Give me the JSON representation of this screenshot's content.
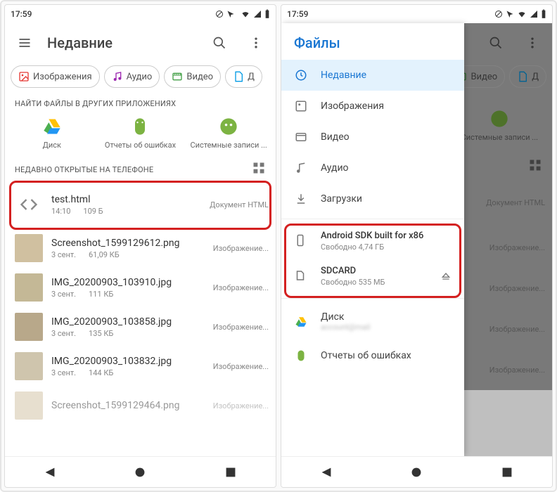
{
  "left": {
    "time": "17:59",
    "appbar_title": "Недавние",
    "chips": [
      {
        "icon": "image-icon",
        "label": "Изображения",
        "color": "#e53935"
      },
      {
        "icon": "music-icon",
        "label": "Аудио",
        "color": "#9c27b0"
      },
      {
        "icon": "video-icon",
        "label": "Видео",
        "color": "#43a047"
      },
      {
        "icon": "doc-icon",
        "label": "Д",
        "color": "#039be5"
      }
    ],
    "section_find": "НАЙТИ ФАЙЛЫ В ДРУГИХ ПРИЛОЖЕНИЯХ",
    "apps": [
      {
        "name": "Диск",
        "icon": "drive"
      },
      {
        "name": "Отчеты об ошибках",
        "icon": "android-green"
      },
      {
        "name": "Системные записи ...",
        "icon": "android-dot"
      }
    ],
    "section_recent": "НЕДАВНО ОТКРЫТЫЕ НА ТЕЛЕФОНЕ",
    "files": [
      {
        "name": "test.html",
        "time": "14:10",
        "size": "109 Б",
        "type": "Документ HTML",
        "thumb": "code"
      },
      {
        "name": "Screenshot_1599129612.png",
        "time": "3 сент.",
        "size": "61,09 КБ",
        "type": "Изображение...",
        "thumb": "img"
      },
      {
        "name": "IMG_20200903_103910.jpg",
        "time": "3 сент.",
        "size": "111 КБ",
        "type": "Изображение...",
        "thumb": "img"
      },
      {
        "name": "IMG_20200903_103858.jpg",
        "time": "3 сент.",
        "size": "135 КБ",
        "type": "Изображение...",
        "thumb": "img"
      },
      {
        "name": "IMG_20200903_103832.jpg",
        "time": "3 сент.",
        "size": "144 КБ",
        "type": "Изображение...",
        "thumb": "img"
      },
      {
        "name": "Screenshot_1599129464.png",
        "time": "",
        "size": "",
        "type": "Изображение...",
        "thumb": "img"
      }
    ]
  },
  "right": {
    "time": "17:59",
    "appbar_title_bg": "Недавние",
    "drawer_title": "Файлы",
    "chips_bg": [
      {
        "label": "Видео",
        "color": "#43a047"
      },
      {
        "label": "Д",
        "color": "#039be5"
      }
    ],
    "bg_apps": [
      {
        "name": "Системные записи ...",
        "icon": "android-dot"
      }
    ],
    "bg_files": [
      {
        "type": "Документ HTML"
      },
      {
        "type": "Изображение..."
      },
      {
        "type": "Изображение..."
      },
      {
        "type": "Изображение..."
      },
      {
        "type": "Изображение..."
      }
    ],
    "drawer": {
      "items": [
        {
          "icon": "clock-icon",
          "label": "Недавние",
          "active": true
        },
        {
          "icon": "image-icon",
          "label": "Изображения"
        },
        {
          "icon": "video-icon",
          "label": "Видео"
        },
        {
          "icon": "music-icon",
          "label": "Аудио"
        },
        {
          "icon": "download-icon",
          "label": "Загрузки"
        }
      ],
      "storage": [
        {
          "icon": "phone-icon",
          "title": "Android SDK built for x86",
          "free": "Свободно 4,74 ГБ"
        },
        {
          "icon": "sd-icon",
          "title": "SDCARD",
          "free": "Свободно 535 МБ",
          "eject": true
        }
      ],
      "extra": [
        {
          "icon": "drive",
          "label": "Диск",
          "sub": ""
        },
        {
          "icon": "android-green",
          "label": "Отчеты об ошибках"
        }
      ]
    }
  }
}
